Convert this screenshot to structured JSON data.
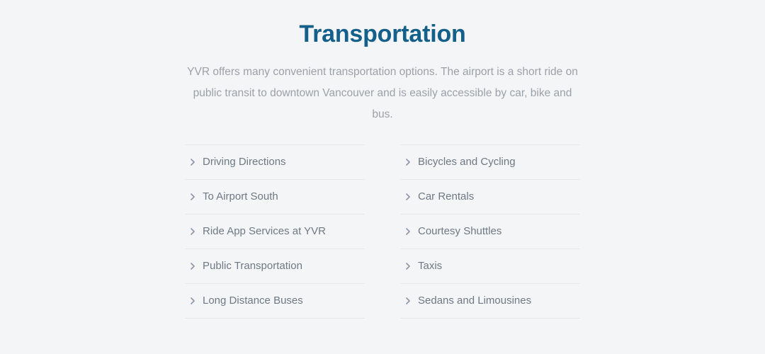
{
  "page": {
    "title": "Transportation",
    "intro": "YVR offers many convenient transportation options. The airport is a short ride on public transit to downtown Vancouver and is easily accessible by car, bike and bus.",
    "background_color": "#f4f5f7",
    "title_color": "#15608a",
    "intro_color": "#9ba1a8",
    "link_color": "#6e7984",
    "chevron_color": "#8c98a7",
    "divider_color": "#e6e8ea"
  },
  "columns": [
    {
      "name": "left-column",
      "items": [
        {
          "label": "Driving Directions",
          "icon": "chevron-right-icon"
        },
        {
          "label": "To Airport South",
          "icon": "chevron-right-icon"
        },
        {
          "label": "Ride App Services at YVR",
          "icon": "chevron-right-icon"
        },
        {
          "label": "Public Transportation",
          "icon": "chevron-right-icon"
        },
        {
          "label": "Long Distance Buses",
          "icon": "chevron-right-icon"
        }
      ]
    },
    {
      "name": "right-column",
      "items": [
        {
          "label": "Bicycles and Cycling",
          "icon": "chevron-right-icon"
        },
        {
          "label": "Car Rentals",
          "icon": "chevron-right-icon"
        },
        {
          "label": "Courtesy Shuttles",
          "icon": "chevron-right-icon"
        },
        {
          "label": "Taxis",
          "icon": "chevron-right-icon"
        },
        {
          "label": "Sedans and Limousines",
          "icon": "chevron-right-icon"
        }
      ]
    }
  ]
}
